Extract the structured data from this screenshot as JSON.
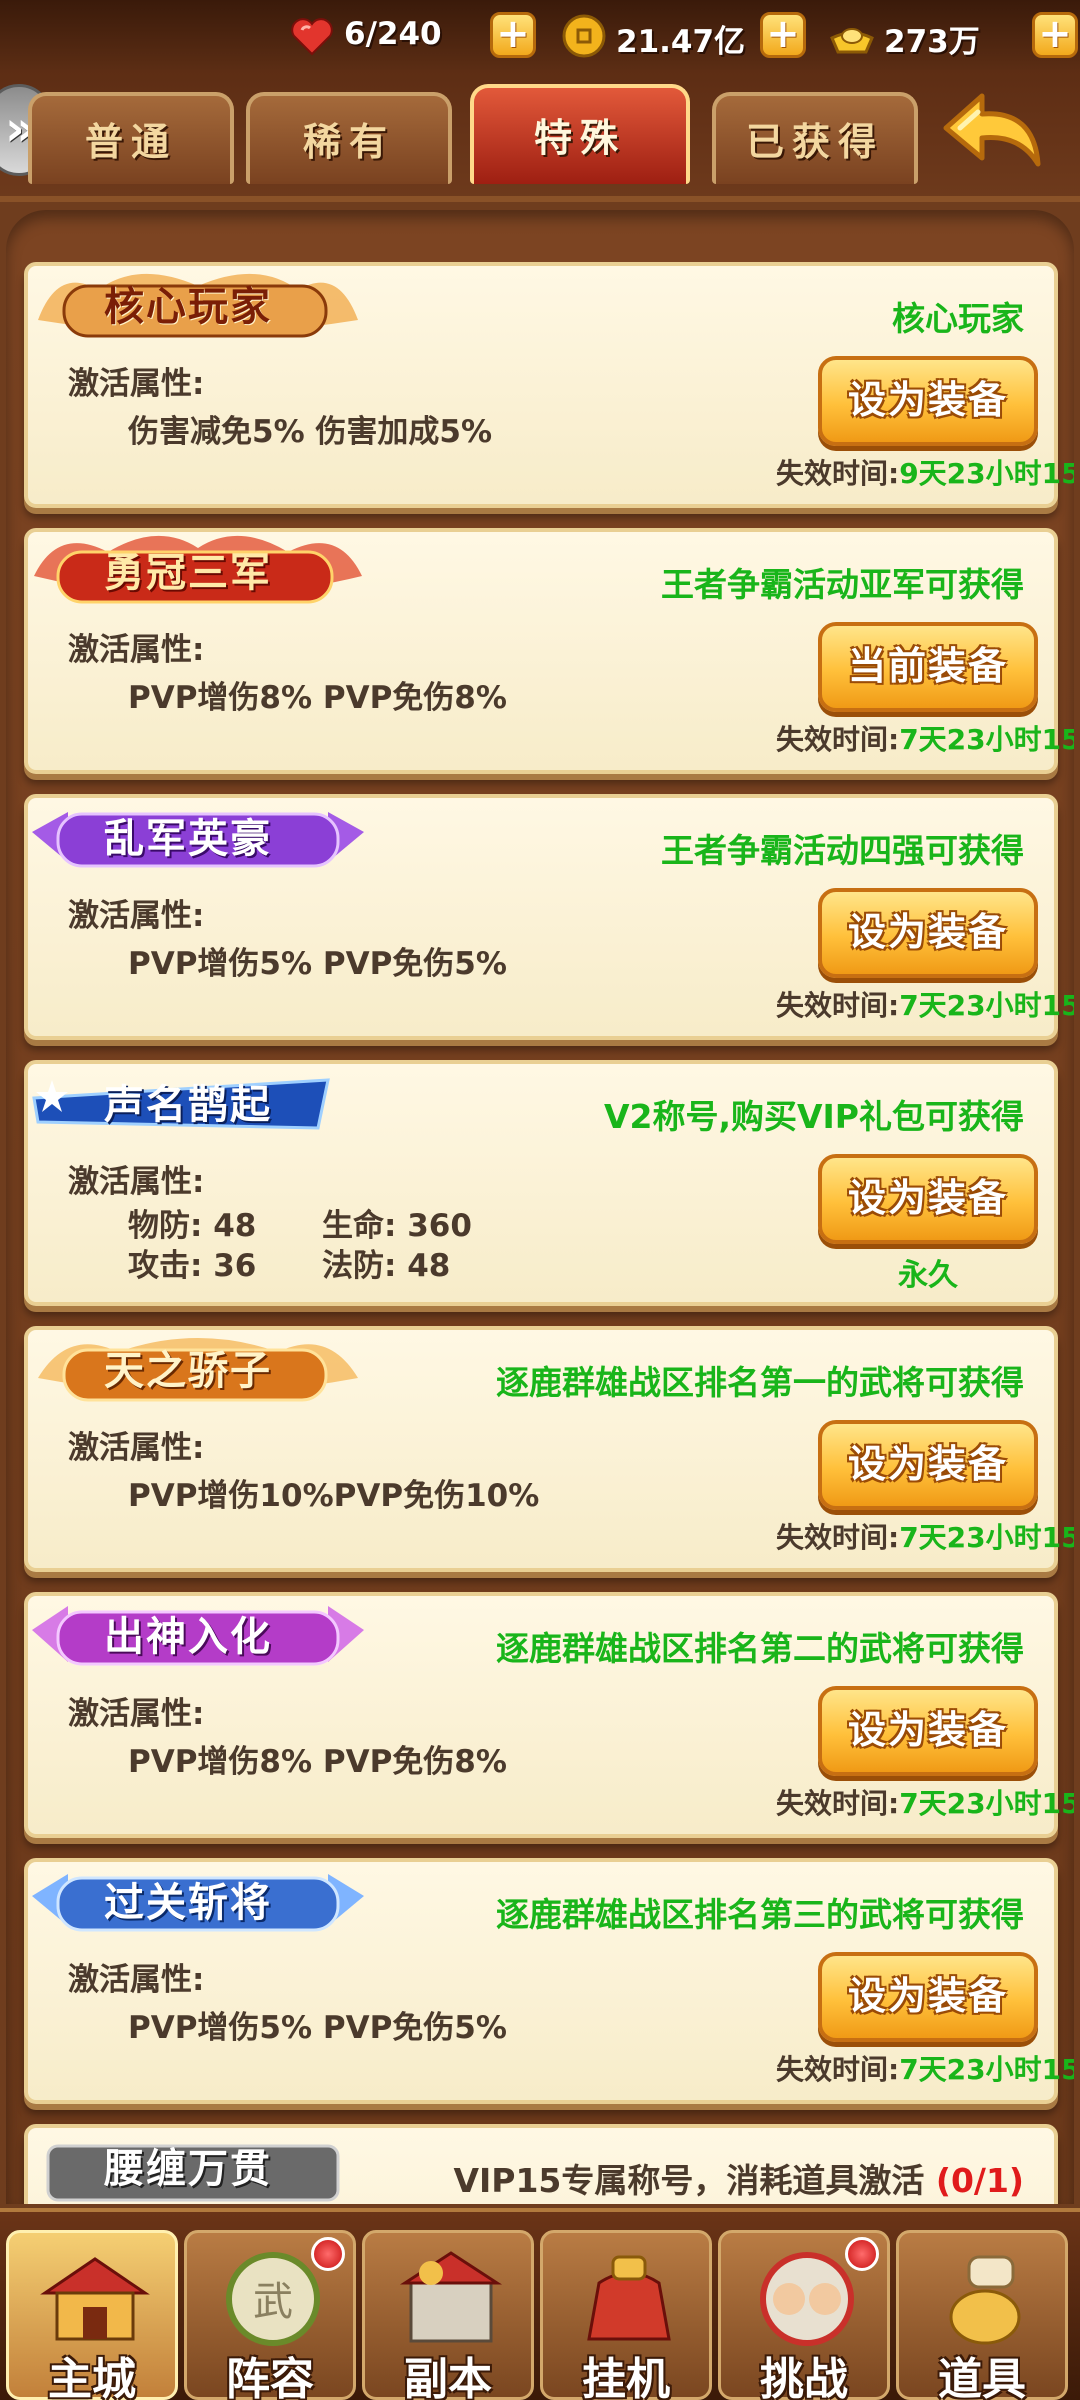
{
  "resources": [
    {
      "icon": "heart-stamina-icon",
      "value": "6/240",
      "color": "#e2352d"
    },
    {
      "icon": "gold-coin-icon",
      "value": "21.47亿",
      "color": "#f2b31c"
    },
    {
      "icon": "gold-ingot-icon",
      "value": "273万",
      "color": "#f7c62a"
    }
  ],
  "tabs": [
    {
      "label": "普通"
    },
    {
      "label": "稀有"
    },
    {
      "label": "特殊",
      "active": true
    },
    {
      "label": "已获得"
    }
  ],
  "cards": [
    {
      "badge": "核心玩家",
      "badge_color": "#c8461e",
      "source": "核心玩家",
      "attr_label": "激活属性:",
      "attrs": "伤害减免5% 伤害加成5%",
      "button": "设为装备",
      "expiry_label": "失效时间:",
      "expiry": "9天23小时15"
    },
    {
      "badge": "勇冠三军",
      "badge_color": "#d0331c",
      "source": "王者争霸活动亚军可获得",
      "attr_label": "激活属性:",
      "attrs": "PVP增伤8% PVP免伤8%",
      "button": "当前装备",
      "expiry_label": "失效时间:",
      "expiry": "7天23小时15"
    },
    {
      "badge": "乱军英豪",
      "badge_color": "#8b3fd6",
      "source": "王者争霸活动四强可获得",
      "attr_label": "激活属性:",
      "attrs": "PVP增伤5% PVP免伤5%",
      "button": "设为装备",
      "expiry_label": "失效时间:",
      "expiry": "7天23小时15"
    },
    {
      "badge": "声名鹊起",
      "badge_color": "#1d4fb8",
      "source": "V2称号,购买VIP礼包可获得",
      "attr_label": "激活属性:",
      "stats": [
        {
          "label": "物防:",
          "value": "48"
        },
        {
          "label": "生命:",
          "value": "360"
        },
        {
          "label": "攻击:",
          "value": "36"
        },
        {
          "label": "法防:",
          "value": "48"
        }
      ],
      "button": "设为装备",
      "permanent": "永久"
    },
    {
      "badge": "天之骄子",
      "badge_color": "#d9761c",
      "source": "逐鹿群雄战区排名第一的武将可获得",
      "attr_label": "激活属性:",
      "attrs": "PVP增伤10%PVP免伤10%",
      "button": "设为装备",
      "expiry_label": "失效时间:",
      "expiry": "7天23小时15"
    },
    {
      "badge": "出神入化",
      "badge_color": "#b43cc8",
      "source": "逐鹿群雄战区排名第二的武将可获得",
      "attr_label": "激活属性:",
      "attrs": "PVP增伤8% PVP免伤8%",
      "button": "设为装备",
      "expiry_label": "失效时间:",
      "expiry": "7天23小时15"
    },
    {
      "badge": "过关斩将",
      "badge_color": "#3a6fd0",
      "source": "逐鹿群雄战区排名第三的武将可获得",
      "attr_label": "激活属性:",
      "attrs": "PVP增伤5% PVP免伤5%",
      "button": "设为装备",
      "expiry_label": "失效时间:",
      "expiry": "7天23小时15"
    },
    {
      "badge": "腰缠万贯",
      "badge_color": "#6a6a6a",
      "source_prefix": "VIP15专属称号，消耗道具激活 ",
      "source_count": "(0/1)"
    }
  ],
  "nav": [
    {
      "label": "主城",
      "icon": "palace-icon",
      "active": true
    },
    {
      "label": "阵容",
      "icon": "war-drum-icon",
      "badge": true
    },
    {
      "label": "副本",
      "icon": "fortress-icon"
    },
    {
      "label": "挂机",
      "icon": "treasure-bag-icon"
    },
    {
      "label": "挑战",
      "icon": "duel-icon",
      "badge": true
    },
    {
      "label": "道具",
      "icon": "scroll-pot-icon"
    }
  ]
}
